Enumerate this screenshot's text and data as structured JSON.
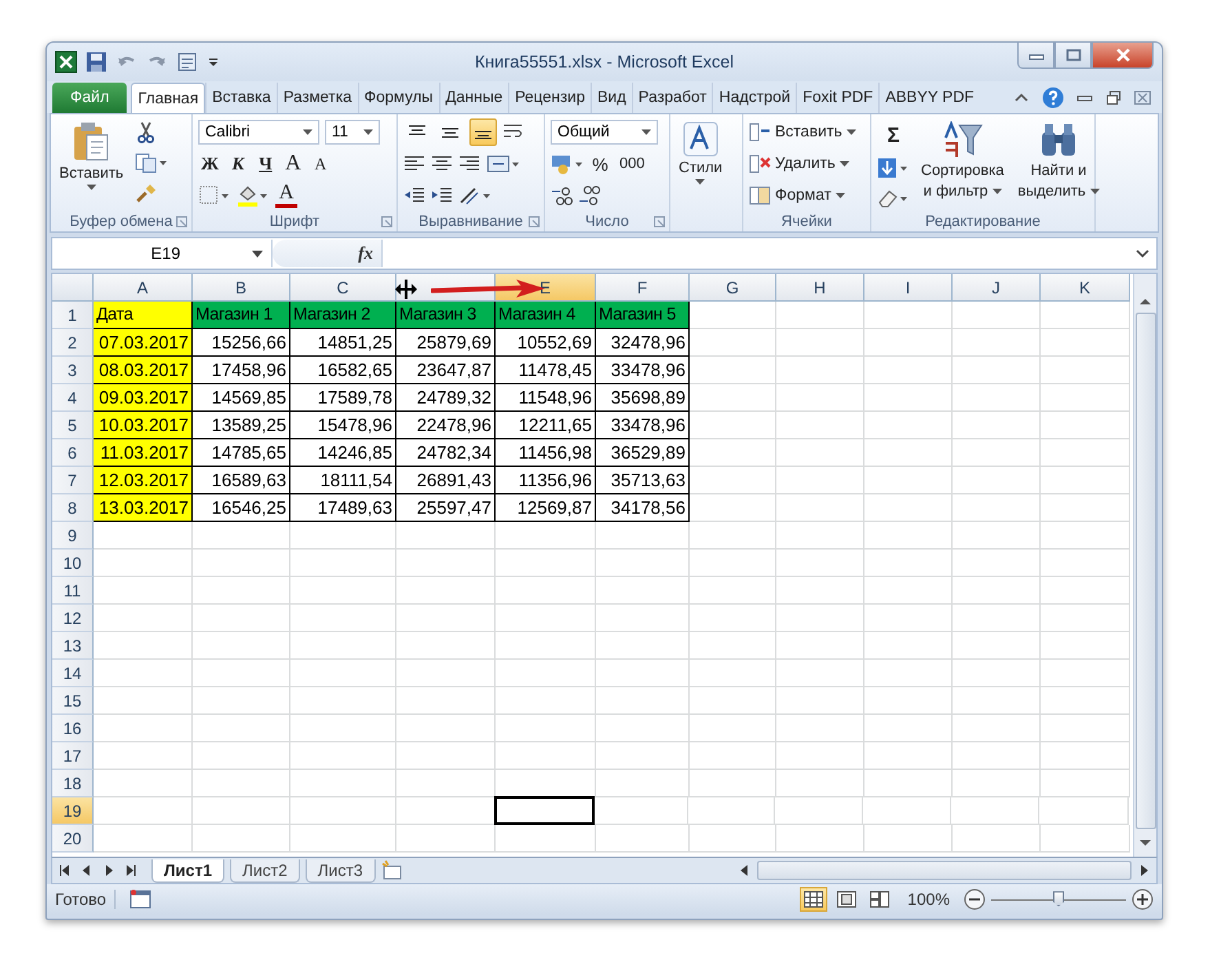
{
  "title_bar": {
    "title": "Книга55551.xlsx - Microsoft Excel"
  },
  "tabs": [
    {
      "label": "Файл",
      "kind": "file",
      "selected": false
    },
    {
      "label": "Главная",
      "kind": "tab",
      "selected": true
    },
    {
      "label": "Вставка",
      "kind": "tab",
      "selected": false
    },
    {
      "label": "Разметка",
      "kind": "tab",
      "selected": false
    },
    {
      "label": "Формулы",
      "kind": "tab",
      "selected": false
    },
    {
      "label": "Данные",
      "kind": "tab",
      "selected": false
    },
    {
      "label": "Рецензир",
      "kind": "tab",
      "selected": false
    },
    {
      "label": "Вид",
      "kind": "tab",
      "selected": false
    },
    {
      "label": "Разработ",
      "kind": "tab",
      "selected": false
    },
    {
      "label": "Надстрой",
      "kind": "tab",
      "selected": false
    },
    {
      "label": "Foxit PDF",
      "kind": "tab",
      "selected": false
    },
    {
      "label": "ABBYY PDF",
      "kind": "tab",
      "selected": false
    }
  ],
  "ribbon": {
    "clipboard": {
      "paste": "Вставить",
      "label": "Буфер обмена"
    },
    "font": {
      "name": "Calibri",
      "size": "11",
      "bold": "Ж",
      "italic": "К",
      "underline": "Ч",
      "grow": "A",
      "shrink": "A",
      "font_color": "A",
      "label": "Шрифт"
    },
    "alignment": {
      "vertical": [
        {
          "kind": "top",
          "selected": false
        },
        {
          "kind": "middle",
          "selected": false
        },
        {
          "kind": "bottom",
          "selected": true
        }
      ],
      "label": "Выравнивание"
    },
    "number": {
      "format": "Общий",
      "percent": "%",
      "thousands": "000",
      "label": "Число"
    },
    "styles": {
      "button": "Стили"
    },
    "cells": {
      "items": [
        "Вставить",
        "Удалить",
        "Формат"
      ],
      "label": "Ячейки"
    },
    "editing": {
      "sum": "Σ",
      "sort": [
        "Сортировка",
        "и фильтр"
      ],
      "find": [
        "Найти и",
        "выделить"
      ],
      "label": "Редактирование"
    }
  },
  "formula_bar": {
    "name_box": "E19",
    "fx": "fx"
  },
  "sheet": {
    "columns": [
      {
        "label": "A",
        "selected": false
      },
      {
        "label": "B",
        "selected": false
      },
      {
        "label": "C",
        "selected": false
      },
      {
        "selected": false
      },
      {
        "label": "E",
        "selected": true
      },
      {
        "label": "F",
        "selected": false
      },
      {
        "label": "G",
        "selected": false
      },
      {
        "label": "H",
        "selected": false
      },
      {
        "label": "I",
        "selected": false
      },
      {
        "label": "J",
        "selected": false
      },
      {
        "label": "K",
        "selected": false
      }
    ],
    "rows": [
      {
        "number": "1",
        "selected": false
      },
      {
        "number": "2",
        "selected": false
      },
      {
        "number": "3",
        "selected": false
      },
      {
        "number": "4",
        "selected": false
      },
      {
        "number": "5",
        "selected": false
      },
      {
        "number": "6",
        "selected": false
      },
      {
        "number": "7",
        "selected": false
      },
      {
        "number": "8",
        "selected": false
      },
      {
        "number": "9",
        "selected": false
      },
      {
        "number": "10",
        "selected": false
      },
      {
        "number": "11",
        "selected": false
      },
      {
        "number": "12",
        "selected": false
      },
      {
        "number": "13",
        "selected": false
      },
      {
        "number": "14",
        "selected": false
      },
      {
        "number": "15",
        "selected": false
      },
      {
        "number": "16",
        "selected": false
      },
      {
        "number": "17",
        "selected": false
      },
      {
        "number": "18",
        "selected": false
      },
      {
        "number": "19",
        "selected": true
      },
      {
        "number": "20",
        "selected": false
      }
    ],
    "header_cells": [
      {
        "text": "Дата",
        "color": "#ffff00"
      },
      {
        "text": "Магазин 1",
        "color": "#00b050"
      },
      {
        "text": "Магазин 2",
        "color": "#00b050"
      },
      {
        "text": "Магазин 3",
        "color": "#00b050"
      },
      {
        "text": "Магазин 4",
        "color": "#00b050"
      },
      {
        "text": "Магазин 5",
        "color": "#00b050"
      }
    ],
    "date_column": {
      "color": "#ffff00"
    },
    "records": [
      {
        "date": "07.03.2017",
        "values": [
          "15256,66",
          "14851,25",
          "25879,69",
          "10552,69",
          "32478,96"
        ]
      },
      {
        "date": "08.03.2017",
        "values": [
          "17458,96",
          "16582,65",
          "23647,87",
          "11478,45",
          "33478,96"
        ]
      },
      {
        "date": "09.03.2017",
        "values": [
          "14569,85",
          "17589,78",
          "24789,32",
          "11548,96",
          "35698,89"
        ]
      },
      {
        "date": "10.03.2017",
        "values": [
          "13589,25",
          "15478,96",
          "22478,96",
          "12211,65",
          "33478,96"
        ]
      },
      {
        "date": "11.03.2017",
        "values": [
          "14785,65",
          "14246,85",
          "24782,34",
          "11456,98",
          "36529,89"
        ]
      },
      {
        "date": "12.03.2017",
        "values": [
          "16589,63",
          "18111,54",
          "26891,43",
          "11356,96",
          "35713,63"
        ]
      },
      {
        "date": "13.03.2017",
        "values": [
          "16546,25",
          "17489,63",
          "25597,47",
          "12569,87",
          "34178,56"
        ]
      }
    ]
  },
  "sheet_tabs": [
    {
      "label": "Лист1",
      "selected": true
    },
    {
      "label": "Лист2",
      "selected": false
    },
    {
      "label": "Лист3",
      "selected": false
    }
  ],
  "status_bar": {
    "status": "Готово",
    "views": [
      {
        "kind": "normal",
        "selected": true
      },
      {
        "kind": "layout",
        "selected": false
      },
      {
        "kind": "pagebreak",
        "selected": false
      }
    ],
    "zoom": "100%",
    "zoom_slider": {
      "level": 0.5
    }
  }
}
